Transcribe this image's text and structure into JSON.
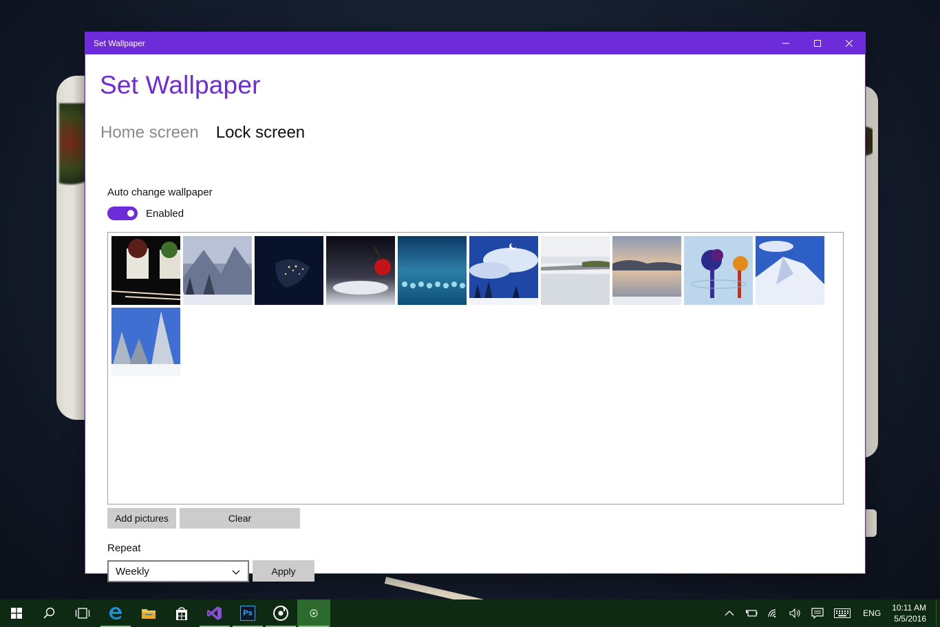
{
  "window": {
    "title": "Set Wallpaper",
    "accent": "#6d2bd9"
  },
  "app": {
    "heading": "Set Wallpaper",
    "tabs": [
      {
        "label": "Home screen",
        "active": false
      },
      {
        "label": "Lock screen",
        "active": true
      }
    ],
    "auto_change": {
      "label": "Auto change wallpaper",
      "toggle_text": "Enabled",
      "enabled": true
    },
    "gallery": {
      "images": [
        {
          "name": "succulents-planter"
        },
        {
          "name": "snowy-mountains"
        },
        {
          "name": "earth-night-lights"
        },
        {
          "name": "cherry-water-drop"
        },
        {
          "name": "blue-water-drops"
        },
        {
          "name": "moon-snow-forest"
        },
        {
          "name": "misty-lake"
        },
        {
          "name": "lake-sunrise"
        },
        {
          "name": "ink-in-water"
        },
        {
          "name": "snowy-peak"
        },
        {
          "name": "snowy-pines"
        }
      ]
    },
    "buttons": {
      "add": "Add pictures",
      "clear": "Clear",
      "apply": "Apply"
    },
    "repeat": {
      "label": "Repeat",
      "selected": "Weekly"
    }
  },
  "taskbar": {
    "apps": [
      {
        "icon": "windows-start-icon"
      },
      {
        "icon": "search-icon"
      },
      {
        "icon": "task-view-icon"
      },
      {
        "icon": "edge-browser-icon"
      },
      {
        "icon": "file-explorer-icon"
      },
      {
        "icon": "store-icon"
      },
      {
        "icon": "visual-studio-icon"
      },
      {
        "icon": "photoshop-icon",
        "label": "Ps"
      },
      {
        "icon": "groove-music-icon"
      },
      {
        "icon": "set-wallpaper-app-icon"
      }
    ],
    "tray": {
      "language": "ENG",
      "time": "10:11 AM",
      "date": "5/5/2016"
    }
  }
}
